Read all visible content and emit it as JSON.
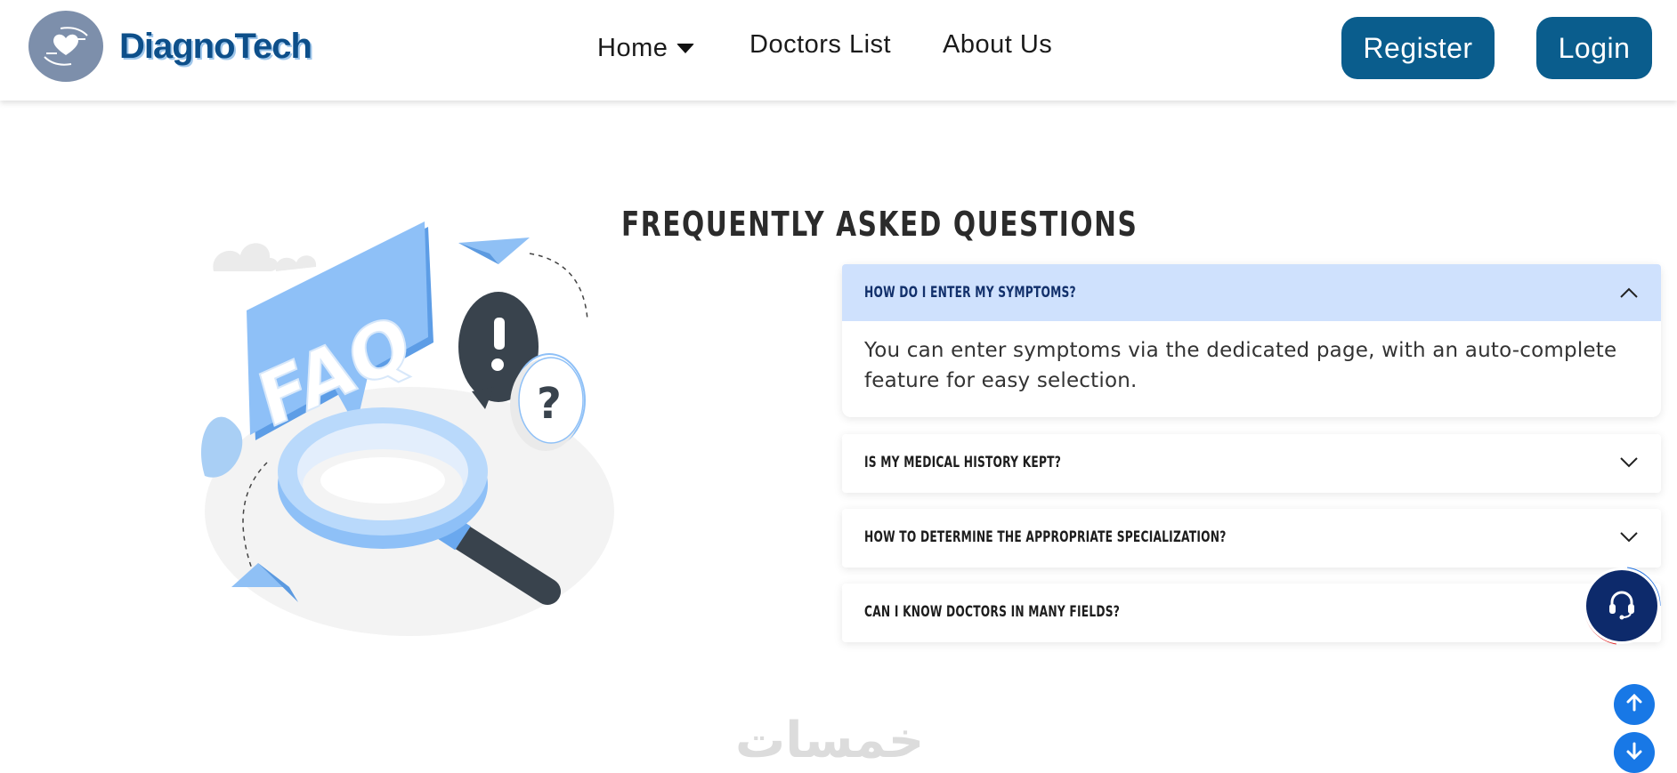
{
  "header": {
    "brand": "DiagnoTech",
    "logo_icon": "heart-hands-icon",
    "nav": {
      "home": "Home",
      "doctors": "Doctors List",
      "about": "About Us"
    },
    "register_label": "Register",
    "login_label": "Login"
  },
  "faq": {
    "title": "FREQUENTLY ASKED QUESTIONS",
    "illustration_label": "FAQ",
    "items": [
      {
        "question": "HOW DO I ENTER MY SYMPTOMS?",
        "answer": "You can enter symptoms via the dedicated page, with an auto-complete feature for easy selection.",
        "expanded": true
      },
      {
        "question": "IS MY MEDICAL HISTORY KEPT?",
        "expanded": false
      },
      {
        "question": "HOW TO DETERMINE THE APPROPRIATE SPECIALIZATION?",
        "expanded": false
      },
      {
        "question": "CAN I KNOW DOCTORS IN MANY FIELDS?",
        "expanded": false
      }
    ]
  },
  "floating": {
    "support_icon": "headset-icon",
    "scroll_up_icon": "arrow-up-icon",
    "scroll_down_icon": "arrow-down-icon"
  },
  "watermark": "خمسات",
  "colors": {
    "brand": "#0d4f8a",
    "button": "#0a5d8d",
    "active_question_bg": "#cfe1fd",
    "support": "#0d2a6b",
    "scroll": "#1878e6"
  }
}
